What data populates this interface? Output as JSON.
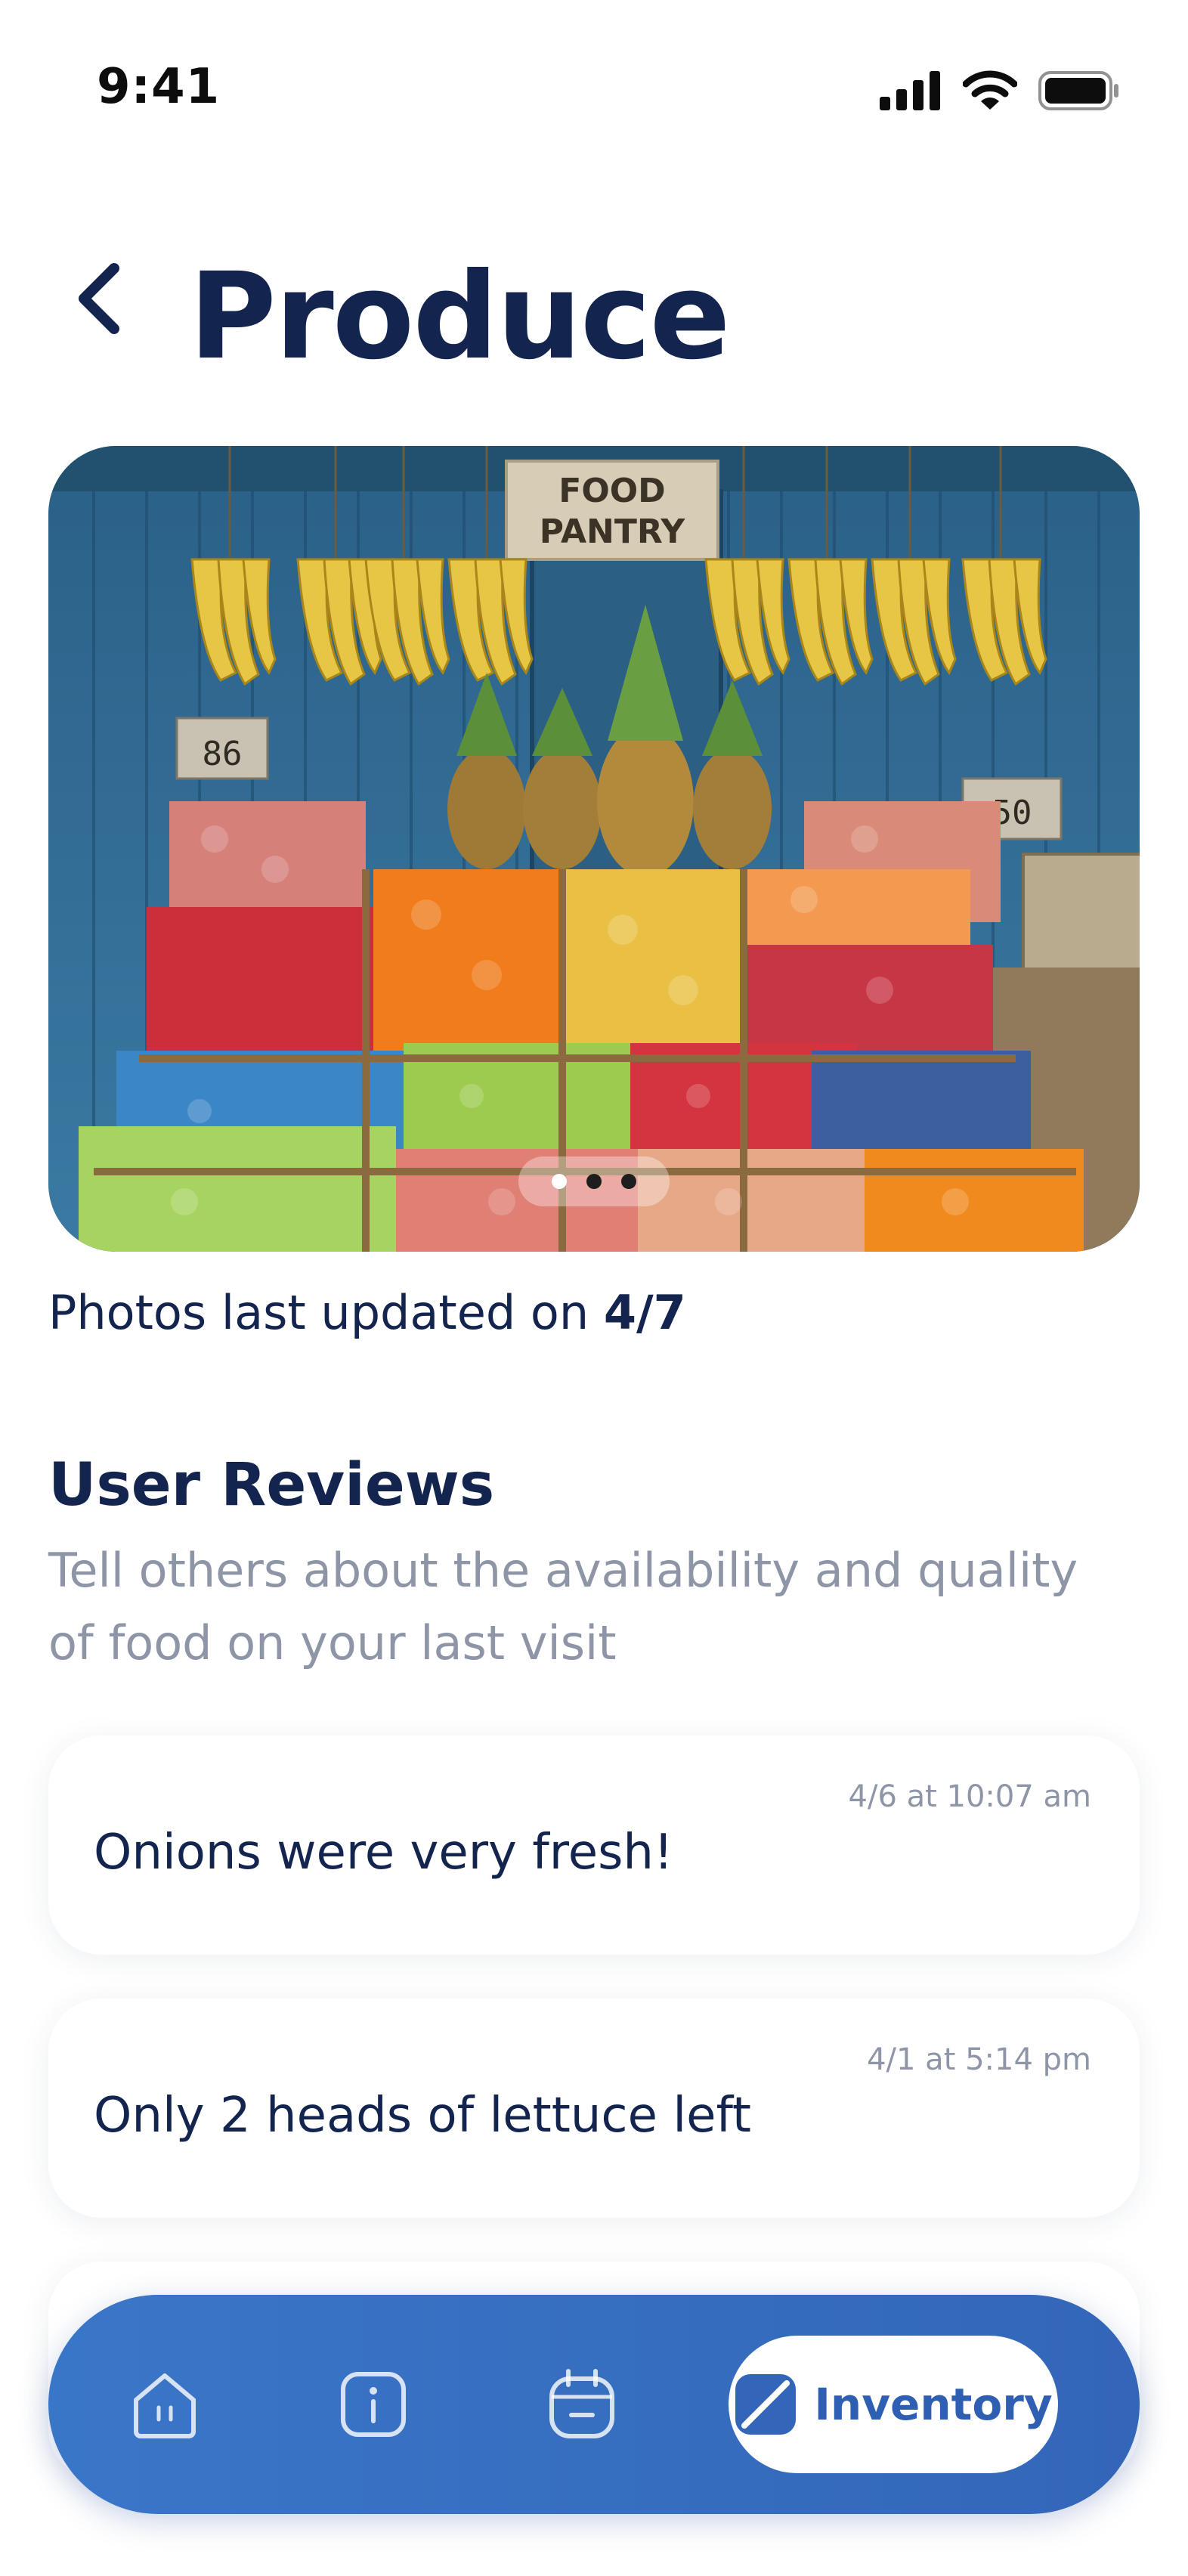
{
  "status_bar": {
    "time": "9:41"
  },
  "header": {
    "back_icon": "chevron-left-icon",
    "title": "Produce"
  },
  "photo": {
    "sign_line1": "FOOD",
    "sign_line2": "PANTRY",
    "price_tag_left": "86",
    "price_tag_right": "50",
    "carousel_pages": 3,
    "carousel_active_index": 0,
    "updated_prefix": "Photos last updated on ",
    "updated_date": "4/7"
  },
  "reviews": {
    "title": "User Reviews",
    "subtitle": "Tell others about the availability and quality of food on your last visit",
    "items": [
      {
        "date": "4/6 at 10:07 am",
        "text": "Onions were very fresh!"
      },
      {
        "date": "4/1 at 5:14 pm",
        "text": "Only 2 heads of lettuce left"
      }
    ]
  },
  "bottom_nav": {
    "items": [
      {
        "icon": "home-icon"
      },
      {
        "icon": "info-icon"
      },
      {
        "icon": "calendar-icon"
      }
    ],
    "active": {
      "icon": "inventory-icon",
      "label": "Inventory"
    }
  },
  "colors": {
    "title": "#13254f",
    "muted": "#8d95a6",
    "nav_bg": "#3a76c8",
    "nav_active_text": "#2f5fb3"
  }
}
